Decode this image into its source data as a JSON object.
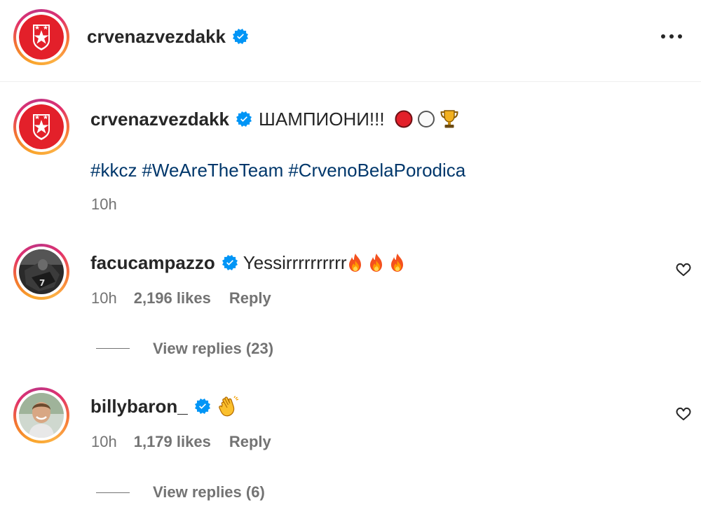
{
  "header": {
    "username": "crvenazvezdakk",
    "more_icon": "more-options-icon"
  },
  "post": {
    "username": "crvenazvezdakk",
    "caption": "ШАМПИОНИ!!!",
    "caption_emojis": [
      "red-circle",
      "white-circle",
      "trophy"
    ],
    "hashtags": [
      "#kkcz",
      "#WeAreTheTeam",
      "#CrvenoBelaPorodica"
    ],
    "time": "10h"
  },
  "comments": [
    {
      "username": "facucampazzo",
      "text": "Yessirrrrrrrrrr",
      "emojis": [
        "fire",
        "fire",
        "fire"
      ],
      "time": "10h",
      "likes": "2,196 likes",
      "reply_label": "Reply",
      "view_replies": "View replies (23)"
    },
    {
      "username": "billybaron_",
      "text": "",
      "emojis": [
        "clapping-hands"
      ],
      "time": "10h",
      "likes": "1,179 likes",
      "reply_label": "Reply",
      "view_replies": "View replies (6)"
    }
  ],
  "colors": {
    "link": "#00376b",
    "verified": "#0095f6",
    "muted": "#737373",
    "club_red": "#e3202a"
  }
}
